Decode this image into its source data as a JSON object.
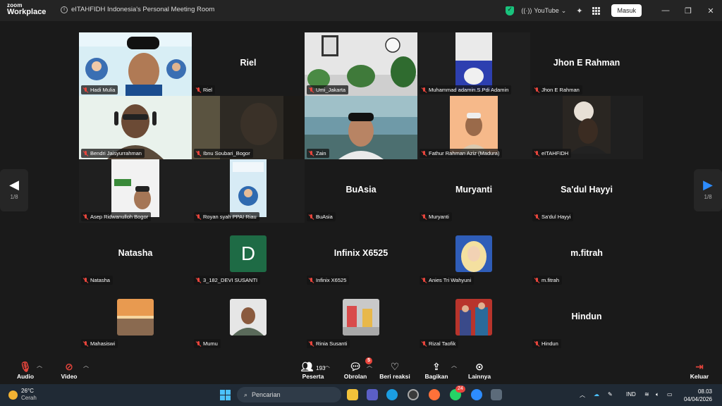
{
  "titlebar": {
    "logo_line1": "zoom",
    "logo_line2": "Workplace",
    "meeting_title": "eITAHFIDH Indonesia's Personal Meeting Room",
    "youtube_label": "YouTube",
    "signin_label": "Masuk"
  },
  "gallery": {
    "page_indicator_left": "1/8",
    "page_indicator_right": "1/8",
    "participants": [
      {
        "name": "Hadi Mulia",
        "display": "photo"
      },
      {
        "name": "Riel",
        "display": "name"
      },
      {
        "name": "Umi_Jakarta",
        "display": "photo"
      },
      {
        "name": "Muhammad adamin.S.Pdi Adamin",
        "display": "photo"
      },
      {
        "name": "Jhon E Rahman",
        "display": "name"
      },
      {
        "name": "Bendri Jaisyurrahman",
        "display": "video",
        "active_speaker": true
      },
      {
        "name": "Ibnu Soubari_Bogor",
        "display": "video"
      },
      {
        "name": "Zain",
        "display": "video"
      },
      {
        "name": "Fathur Rahman Aziz (Madura)",
        "display": "video"
      },
      {
        "name": "eITAHFIDH",
        "display": "video"
      },
      {
        "name": "Asep Ridwanulloh Bogor",
        "display": "video"
      },
      {
        "name": "Royan syah PPAI Riau",
        "display": "photo"
      },
      {
        "name": "BuAsia",
        "display": "name"
      },
      {
        "name": "Muryanti",
        "display": "name"
      },
      {
        "name": "Sa'dul Hayyi",
        "display": "name"
      },
      {
        "name": "Natasha",
        "display": "name"
      },
      {
        "name": "3_182_DEVI SUSANTI",
        "display": "avatar",
        "avatar_letter": "D"
      },
      {
        "name": "Infinix X6525",
        "display": "name"
      },
      {
        "name": "Anies Tri Wahyuni",
        "display": "thumb"
      },
      {
        "name": "m.fitrah",
        "display": "name"
      },
      {
        "name": "Mahasiswi",
        "display": "thumb"
      },
      {
        "name": "Mumu",
        "display": "thumb"
      },
      {
        "name": "Rinia Susanti",
        "display": "thumb"
      },
      {
        "name": "Rizal Taofik",
        "display": "thumb"
      },
      {
        "name": "Hindun",
        "display": "name"
      }
    ]
  },
  "toolbar": {
    "audio_label": "Audio",
    "video_label": "Video",
    "participants_label": "Peserta",
    "participants_count": "193",
    "chat_label": "Obrolan",
    "chat_badge": "5",
    "reactions_label": "Beri reaksi",
    "share_label": "Bagikan",
    "more_label": "Lainnya",
    "leave_label": "Keluar"
  },
  "taskbar": {
    "temperature": "26°C",
    "weather": "Cerah",
    "search_placeholder": "Pencarian",
    "notification_badge": "24",
    "language": "IND",
    "time": "08.03",
    "date": "04/04/2026"
  }
}
